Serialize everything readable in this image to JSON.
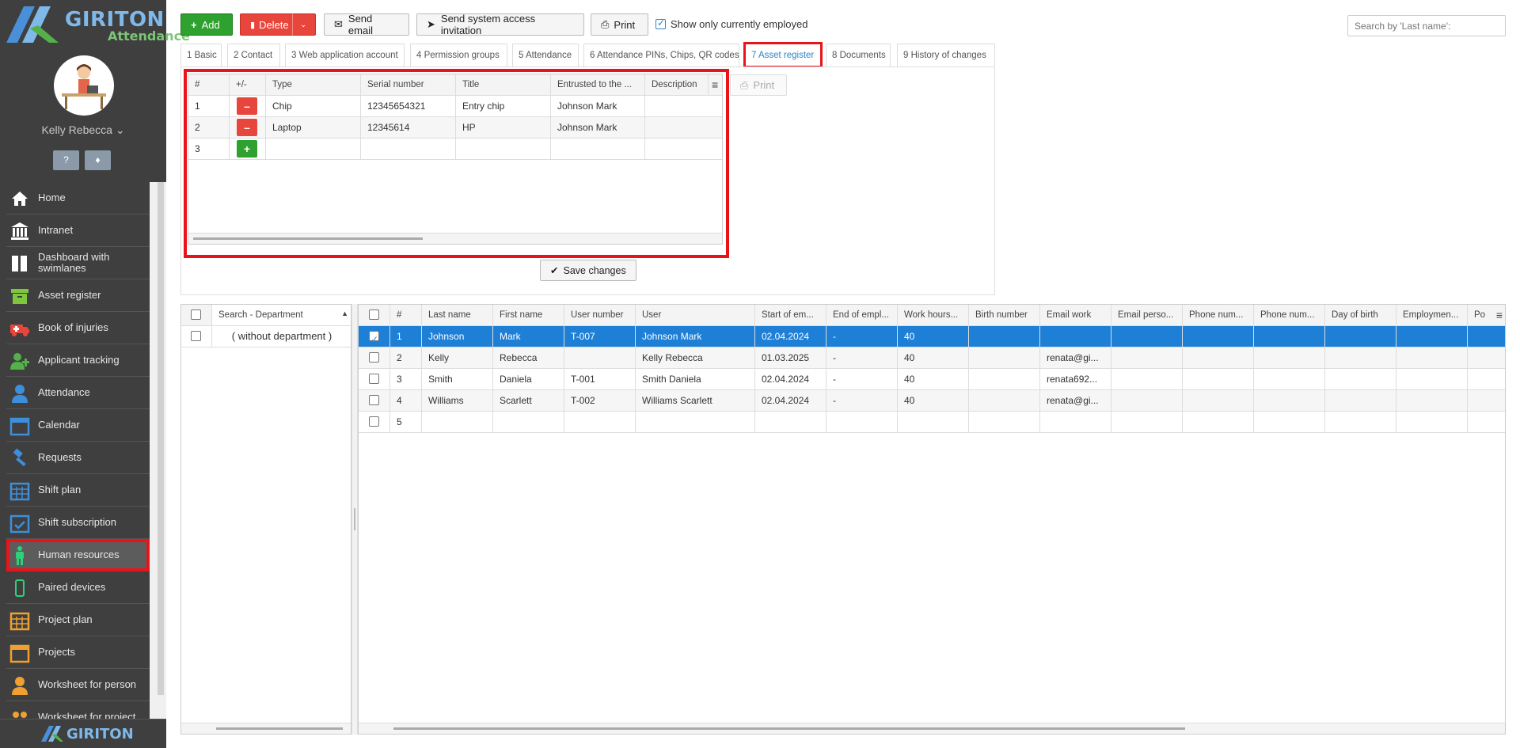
{
  "brand": {
    "name": "GIRITON",
    "product": "Attendance"
  },
  "user": {
    "name": "Kelly Rebecca"
  },
  "sidebar": {
    "items": [
      {
        "label": "Home",
        "icon": "home-icon"
      },
      {
        "label": "Intranet",
        "icon": "bank-icon"
      },
      {
        "label": "Dashboard with swimlanes",
        "icon": "columns-icon"
      },
      {
        "label": "Asset register",
        "icon": "archive-icon"
      },
      {
        "label": "Book of injuries",
        "icon": "ambulance-icon"
      },
      {
        "label": "Applicant tracking",
        "icon": "user-plus-icon"
      },
      {
        "label": "Attendance",
        "icon": "user-icon"
      },
      {
        "label": "Calendar",
        "icon": "calendar-icon"
      },
      {
        "label": "Requests",
        "icon": "gavel-icon"
      },
      {
        "label": "Shift plan",
        "icon": "calendar-grid-icon"
      },
      {
        "label": "Shift subscription",
        "icon": "calendar-check-icon"
      },
      {
        "label": "Human resources",
        "icon": "person-icon"
      },
      {
        "label": "Paired devices",
        "icon": "mobile-icon"
      },
      {
        "label": "Project plan",
        "icon": "calendar-grid-icon"
      },
      {
        "label": "Projects",
        "icon": "folder-icon"
      },
      {
        "label": "Worksheet for person",
        "icon": "user-icon"
      },
      {
        "label": "Worksheet for project",
        "icon": "users-icon"
      }
    ]
  },
  "toolbar": {
    "add": "Add",
    "delete": "Delete",
    "send_email": "Send email",
    "send_invite": "Send system access invitation",
    "print": "Print",
    "only_employed": "Show only currently employed",
    "search_placeholder": "Search by 'Last name':"
  },
  "tabs": [
    "1 Basic",
    "2 Contact",
    "3 Web application account",
    "4 Permission groups",
    "5 Attendance",
    "6 Attendance PINs, Chips, QR codes",
    "7 Asset register",
    "8 Documents",
    "9 History of changes"
  ],
  "asset_grid": {
    "headers": [
      "#",
      "+/-",
      "Type",
      "Serial number",
      "Title",
      "Entrusted to the ...",
      "Description"
    ],
    "rows": [
      {
        "num": "1",
        "type": "Chip",
        "serial": "12345654321",
        "title": "Entry chip",
        "entrusted": "Johnson Mark",
        "desc": ""
      },
      {
        "num": "2",
        "type": "Laptop",
        "serial": "12345614",
        "title": "HP",
        "entrusted": "Johnson Mark",
        "desc": ""
      },
      {
        "num": "3",
        "type": "",
        "serial": "",
        "title": "",
        "entrusted": "",
        "desc": ""
      }
    ],
    "print": "Print",
    "save": "Save changes"
  },
  "dept": {
    "header": "Search - Department",
    "rows": [
      "( without department )"
    ]
  },
  "people": {
    "headers": [
      "#",
      "Last name",
      "First name",
      "User number",
      "User",
      "Start of em...",
      "End of empl...",
      "Work hours...",
      "Birth number",
      "Email work",
      "Email perso...",
      "Phone num...",
      "Phone num...",
      "Day of birth",
      "Employmen...",
      "Po"
    ],
    "rows": [
      {
        "num": "1",
        "last": "Johnson",
        "first": "Mark",
        "usernum": "T-007",
        "user": "Johnson Mark",
        "start": "02.04.2024",
        "end": "-",
        "hours": "40",
        "email": ""
      },
      {
        "num": "2",
        "last": "Kelly",
        "first": "Rebecca",
        "usernum": "",
        "user": "Kelly Rebecca",
        "start": "01.03.2025",
        "end": "-",
        "hours": "40",
        "email": "renata@gi..."
      },
      {
        "num": "3",
        "last": "Smith",
        "first": "Daniela",
        "usernum": "T-001",
        "user": "Smith Daniela",
        "start": "02.04.2024",
        "end": "-",
        "hours": "40",
        "email": "renata692..."
      },
      {
        "num": "4",
        "last": "Williams",
        "first": "Scarlett",
        "usernum": "T-002",
        "user": "Williams Scarlett",
        "start": "02.04.2024",
        "end": "-",
        "hours": "40",
        "email": "renata@gi..."
      },
      {
        "num": "5",
        "last": "",
        "first": "",
        "usernum": "",
        "user": "",
        "start": "",
        "end": "",
        "hours": "",
        "email": ""
      }
    ]
  }
}
